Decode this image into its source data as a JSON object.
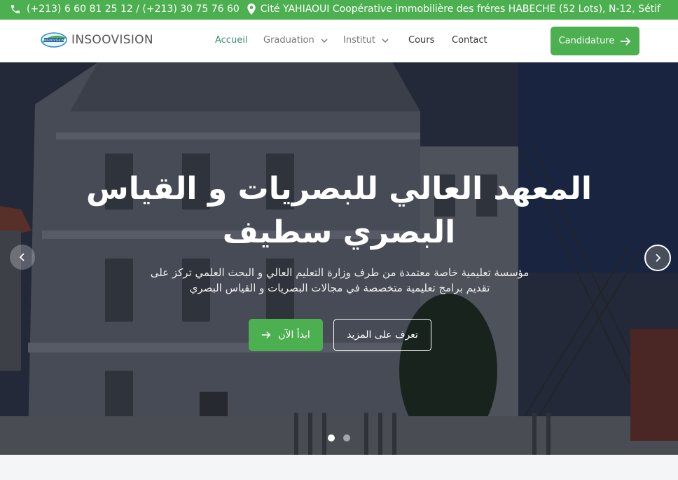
{
  "topbar": {
    "phone_text": "(+213) 6 60 81 25 12  /  (+213) 30 75 76 60",
    "address_text": "Cité YAHIAOUI Coopérative immobilière des fréres HABECHE (52 Lots), N-12, Sétif",
    "phone_icon": "phone-icon",
    "address_icon": "location-pin-icon"
  },
  "navbar": {
    "logo_text": "INSOOVISION",
    "logo_badge": "INSOOVISION",
    "items": [
      {
        "label": "Accueil",
        "active": true
      },
      {
        "label": "Graduation",
        "has_dropdown": true
      },
      {
        "label": "Institut",
        "has_dropdown": true
      },
      {
        "label": "Cours"
      },
      {
        "label": "Contact"
      }
    ],
    "cta_label": "Candidature"
  },
  "hero": {
    "title": "المعهد العالي للبصريات و القياس البصري سطيف",
    "subtitle": "مؤسسة تعليمية خاصة معتمدة من طرف وزارة التعليم العالي و البحث العلمي تركز على تقديم برامج تعليمية متخصصة في مجالات البصريات و القياس البصري",
    "primary_button": "ابدأ الآن",
    "secondary_button": "تعرف على المزيد",
    "slides_total": 2,
    "slide_active": 1
  },
  "colors": {
    "accent": "#4caf50",
    "nav_active": "#3a8f74",
    "text_muted": "#777777"
  }
}
